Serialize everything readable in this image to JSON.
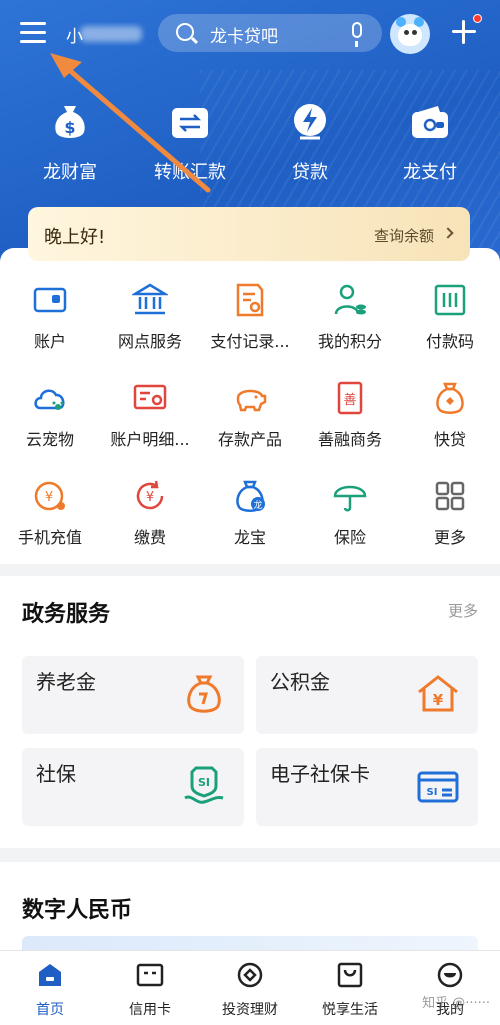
{
  "colors": {
    "brand_blue": "#1f5fc4",
    "orange": "#f07a2c",
    "green": "#1aa07a",
    "red": "#e0463d",
    "annotation": "#f08a3e"
  },
  "topbar": {
    "username_prefix": "小",
    "search_placeholder": "龙卡贷吧"
  },
  "quick_actions": [
    {
      "label": "龙财富",
      "icon": "money-bag-icon"
    },
    {
      "label": "转账汇款",
      "icon": "transfer-icon"
    },
    {
      "label": "贷款",
      "icon": "loan-icon"
    },
    {
      "label": "龙支付",
      "icon": "wallet-icon"
    }
  ],
  "greeting": {
    "text": "晚上好!",
    "balance_link": "查询余额"
  },
  "services": [
    {
      "label": "账户",
      "icon": "account-icon"
    },
    {
      "label": "网点服务",
      "icon": "bank-branch-icon"
    },
    {
      "label": "支付记录...",
      "icon": "payment-record-icon"
    },
    {
      "label": "我的积分",
      "icon": "points-icon"
    },
    {
      "label": "付款码",
      "icon": "pay-code-icon"
    },
    {
      "label": "云宠物",
      "icon": "cloud-pet-icon"
    },
    {
      "label": "账户明细...",
      "icon": "account-detail-icon"
    },
    {
      "label": "存款产品",
      "icon": "piggy-bank-icon"
    },
    {
      "label": "善融商务",
      "icon": "shanrong-icon"
    },
    {
      "label": "快贷",
      "icon": "quick-loan-icon"
    },
    {
      "label": "手机充值",
      "icon": "phone-recharge-icon"
    },
    {
      "label": "缴费",
      "icon": "bill-pay-icon"
    },
    {
      "label": "龙宝",
      "icon": "longbao-icon"
    },
    {
      "label": "保险",
      "icon": "umbrella-icon"
    },
    {
      "label": "更多",
      "icon": "grid-more-icon"
    }
  ],
  "gov": {
    "title": "政务服务",
    "more": "更多",
    "cards": [
      {
        "label": "养老金",
        "icon": "pension-bag-icon"
      },
      {
        "label": "公积金",
        "icon": "housing-fund-icon"
      },
      {
        "label": "社保",
        "icon": "social-security-icon"
      },
      {
        "label": "电子社保卡",
        "icon": "social-card-icon"
      }
    ]
  },
  "digital": {
    "title": "数字人民币"
  },
  "bottom_nav": [
    {
      "label": "首页",
      "icon": "home-icon",
      "active": true
    },
    {
      "label": "信用卡",
      "icon": "credit-card-icon"
    },
    {
      "label": "投资理财",
      "icon": "invest-icon"
    },
    {
      "label": "悦享生活",
      "icon": "life-bag-icon"
    },
    {
      "label": "我的",
      "icon": "profile-icon"
    }
  ],
  "watermark": "知乎 @······"
}
